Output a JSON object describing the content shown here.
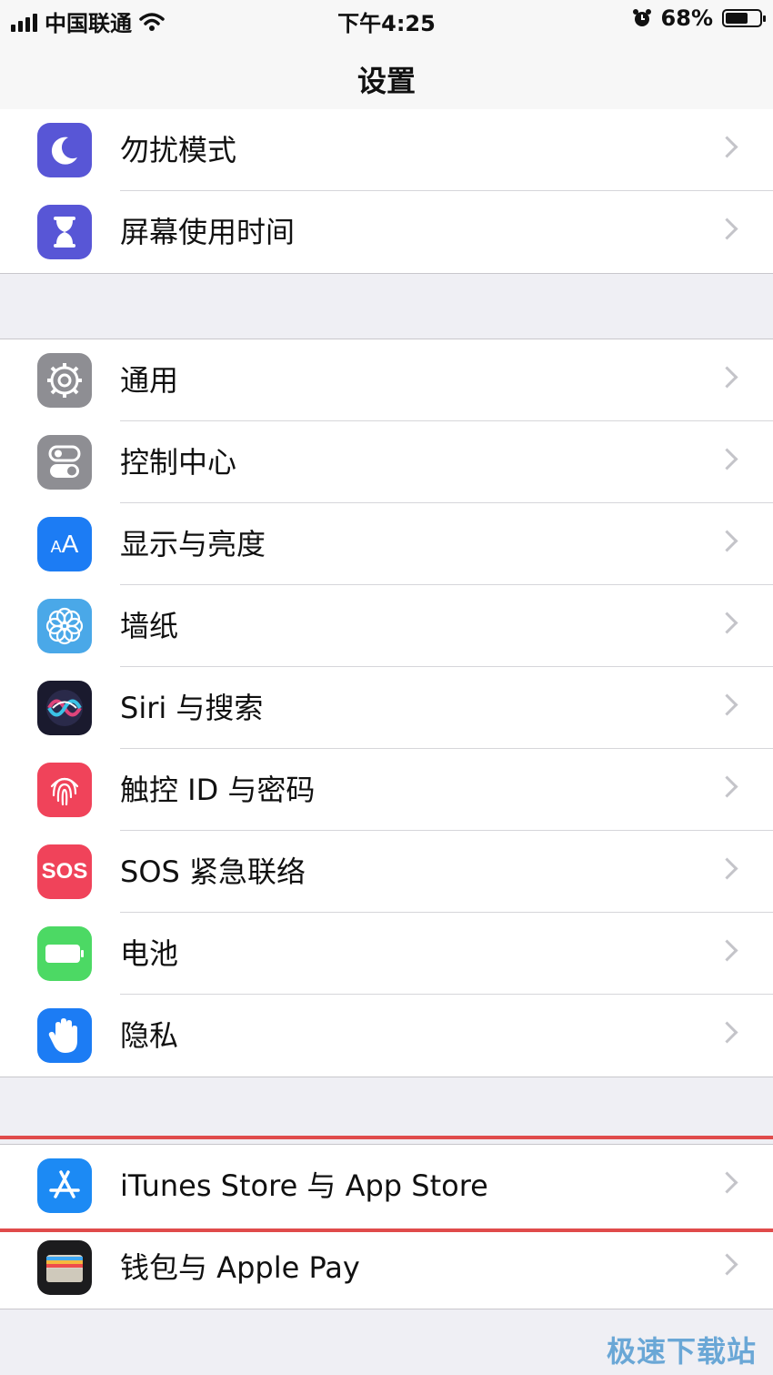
{
  "status_bar": {
    "carrier": "中国联通",
    "time": "下午4:25",
    "battery_percent": "68%",
    "battery_level": 0.68
  },
  "nav": {
    "title": "设置"
  },
  "group1": [
    {
      "label": "勿扰模式",
      "icon": "moon-icon",
      "color": "#5856d6"
    },
    {
      "label": "屏幕使用时间",
      "icon": "hourglass-icon",
      "color": "#5856d6"
    }
  ],
  "group2": [
    {
      "label": "通用",
      "icon": "gear-icon",
      "color": "#8e8e93"
    },
    {
      "label": "控制中心",
      "icon": "toggles-icon",
      "color": "#8e8e93"
    },
    {
      "label": "显示与亮度",
      "icon": "text-size-icon",
      "color": "#1c7cf4",
      "glyph": "AA"
    },
    {
      "label": "墙纸",
      "icon": "flower-icon",
      "color": "#4aa8e8"
    },
    {
      "label": "Siri 与搜索",
      "icon": "siri-icon",
      "color": "#1a1a2e"
    },
    {
      "label": "触控 ID 与密码",
      "icon": "fingerprint-icon",
      "color": "#f0435a"
    },
    {
      "label": "SOS 紧急联络",
      "icon": "sos-icon",
      "color": "#f0435a",
      "glyph": "SOS"
    },
    {
      "label": "电池",
      "icon": "battery-icon",
      "color": "#4cd964"
    },
    {
      "label": "隐私",
      "icon": "hand-icon",
      "color": "#1c7cf4"
    }
  ],
  "group3": [
    {
      "label": "iTunes Store 与 App Store",
      "icon": "app-store-icon",
      "color": "#1c8af4"
    },
    {
      "label": "钱包与 Apple Pay",
      "icon": "wallet-icon",
      "color": "#1c1c1e"
    }
  ],
  "watermark": "极速下载站",
  "accent": {
    "highlight": "#e04b4b"
  }
}
